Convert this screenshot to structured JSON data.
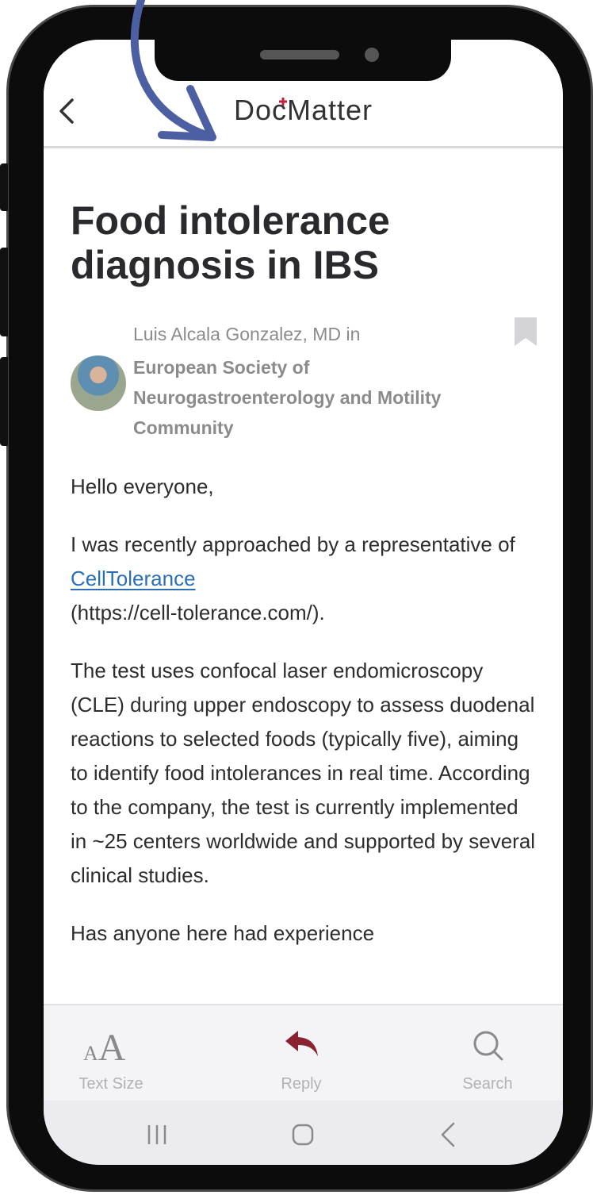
{
  "app": {
    "logo_text_left": "Doc",
    "logo_text_right": "Matter"
  },
  "post": {
    "title": "Food intolerance diagnosis in IBS",
    "author_line": "Luis Alcala Gonzalez, MD in",
    "community": "European Society of Neurogastroenterology and Motility Community",
    "greeting": "Hello everyone,",
    "para1_prefix": "I was recently approached by a representative of ",
    "para1_link": "CellTolerance",
    "para1_suffix": "(https://cell-tolerance.com/).",
    "para2": "The test uses confocal laser endomicroscopy (CLE) during upper endoscopy to assess duodenal reactions to selected foods (typically five), aiming to identify food intolerances in real time. According to the company, the test is currently implemented in ~25 centers worldwide and supported by several clinical studies.",
    "para3_partial": "Has anyone here had experience"
  },
  "toolbar": {
    "text_size_label": "Text Size",
    "text_size_small": "A",
    "text_size_big": "A",
    "reply_label": "Reply",
    "search_label": "Search"
  },
  "colors": {
    "accent_red": "#8b2232",
    "link_blue": "#2a6fb5",
    "annotation_arrow": "#4d5fa3"
  }
}
